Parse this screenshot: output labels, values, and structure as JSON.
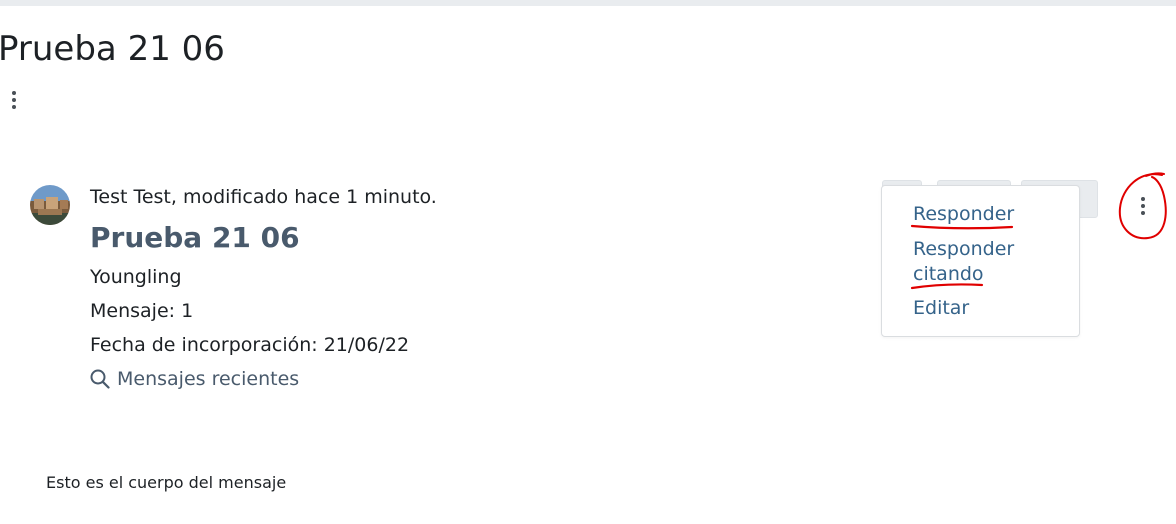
{
  "page": {
    "title": "Prueba 21 06"
  },
  "post": {
    "author_line": "Test Test, modificado hace 1 minuto.",
    "subject": "Prueba 21 06",
    "role": "Youngling",
    "posts_count": "Mensaje: 1",
    "joined": "Fecha de incorporación: 21/06/22",
    "recent_link": "Mensajes recientes",
    "body": "Esto es el cuerpo del mensaje"
  },
  "actions_menu": {
    "items": [
      {
        "label_lines": [
          "Responder"
        ]
      },
      {
        "label_lines": [
          "Responder",
          "citando"
        ]
      },
      {
        "label_lines": [
          "Editar"
        ]
      }
    ]
  },
  "icons": {
    "page_menu": "kebab-vertical-icon",
    "post_menu": "kebab-vertical-icon",
    "search": "search-icon"
  },
  "colors": {
    "link": "#35638a",
    "subject": "#495a6c",
    "annotation": "#e00000"
  }
}
